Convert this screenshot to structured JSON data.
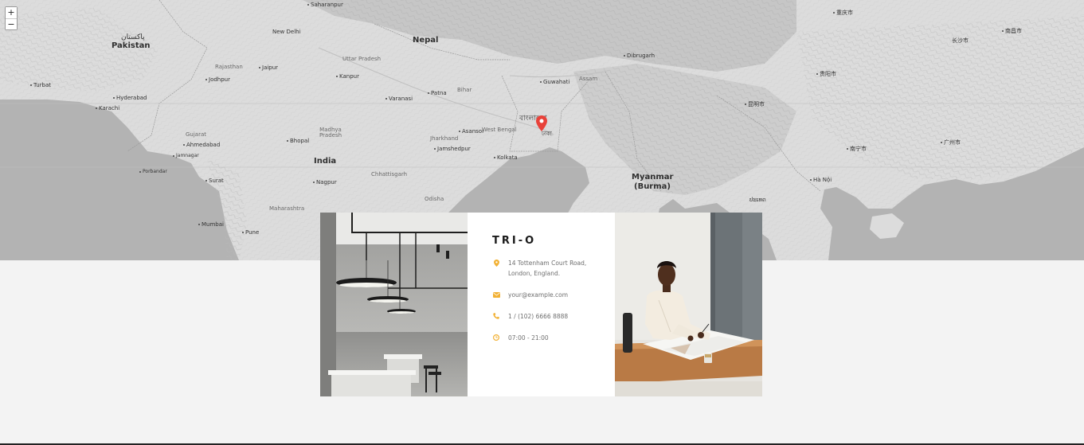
{
  "map": {
    "zoom_in_label": "+",
    "zoom_out_label": "−",
    "marker_icon": "map-pin-icon",
    "marker_color": "#e8423a",
    "labels": [
      {
        "text": "Saharanpur",
        "kind": "city"
      },
      {
        "text": "پاکستان",
        "kind": "plain"
      },
      {
        "text": "Pakistan",
        "kind": "country"
      },
      {
        "text": "New Delhi",
        "kind": "plain"
      },
      {
        "text": "Nepal",
        "kind": "country"
      },
      {
        "text": "Uttar Pradesh",
        "kind": "faint"
      },
      {
        "text": "Rajasthan",
        "kind": "faint"
      },
      {
        "text": "Jaipur",
        "kind": "city"
      },
      {
        "text": "Kanpur",
        "kind": "city"
      },
      {
        "text": "Jodhpur",
        "kind": "city"
      },
      {
        "text": "Turbat",
        "kind": "city"
      },
      {
        "text": "Hyderabad",
        "kind": "city"
      },
      {
        "text": "Karachi",
        "kind": "city"
      },
      {
        "text": "Varanasi",
        "kind": "city"
      },
      {
        "text": "Patna",
        "kind": "city"
      },
      {
        "text": "Bihar",
        "kind": "faint"
      },
      {
        "text": "Guwahati",
        "kind": "city"
      },
      {
        "text": "Dibrugarh",
        "kind": "city"
      },
      {
        "text": "Assam",
        "kind": "faint"
      },
      {
        "text": "বাংলাদেশ",
        "kind": "plain"
      },
      {
        "text": "ঢাকা",
        "kind": "plain"
      },
      {
        "text": "Gujarat",
        "kind": "faint"
      },
      {
        "text": "Ahmedabad",
        "kind": "city"
      },
      {
        "text": "Jamnagar",
        "kind": "city"
      },
      {
        "text": "Madhya Pradesh",
        "kind": "faint"
      },
      {
        "text": "Bhopal",
        "kind": "city"
      },
      {
        "text": "Jharkhand",
        "kind": "faint"
      },
      {
        "text": "Asansol",
        "kind": "city"
      },
      {
        "text": "West Bengal",
        "kind": "faint"
      },
      {
        "text": "Jamshedpur",
        "kind": "city"
      },
      {
        "text": "Kolkata",
        "kind": "city"
      },
      {
        "text": "India",
        "kind": "country"
      },
      {
        "text": "Porbandar",
        "kind": "city"
      },
      {
        "text": "Surat",
        "kind": "city"
      },
      {
        "text": "Nagpur",
        "kind": "city"
      },
      {
        "text": "Chhattisgarh",
        "kind": "faint"
      },
      {
        "text": "Odisha",
        "kind": "faint"
      },
      {
        "text": "Maharashtra",
        "kind": "faint"
      },
      {
        "text": "Mumbai",
        "kind": "city"
      },
      {
        "text": "Pune",
        "kind": "city"
      },
      {
        "text": "Myanmar",
        "kind": "country"
      },
      {
        "text": "(Burma)",
        "kind": "country"
      },
      {
        "text": "重庆市",
        "kind": "city"
      },
      {
        "text": "南昌市",
        "kind": "city"
      },
      {
        "text": "长沙市",
        "kind": "plain"
      },
      {
        "text": "贵阳市",
        "kind": "city"
      },
      {
        "text": "昆明市",
        "kind": "city"
      },
      {
        "text": "南宁市",
        "kind": "city"
      },
      {
        "text": "广州市",
        "kind": "city"
      },
      {
        "text": "Hà Nội",
        "kind": "city"
      },
      {
        "text": "ປະເທດ",
        "kind": "plain"
      }
    ]
  },
  "card": {
    "brand": "TRI-O",
    "address_line1": "14 Tottenham Court Road,",
    "address_line2": "London, England.",
    "email": "your@example.com",
    "phone": "1 / (102) 6666 8888",
    "hours": "07:00 - 21:00",
    "icon_color": "#f2b134",
    "icons": [
      "map-marker-icon",
      "envelope-icon",
      "phone-icon",
      "clock-icon"
    ]
  }
}
